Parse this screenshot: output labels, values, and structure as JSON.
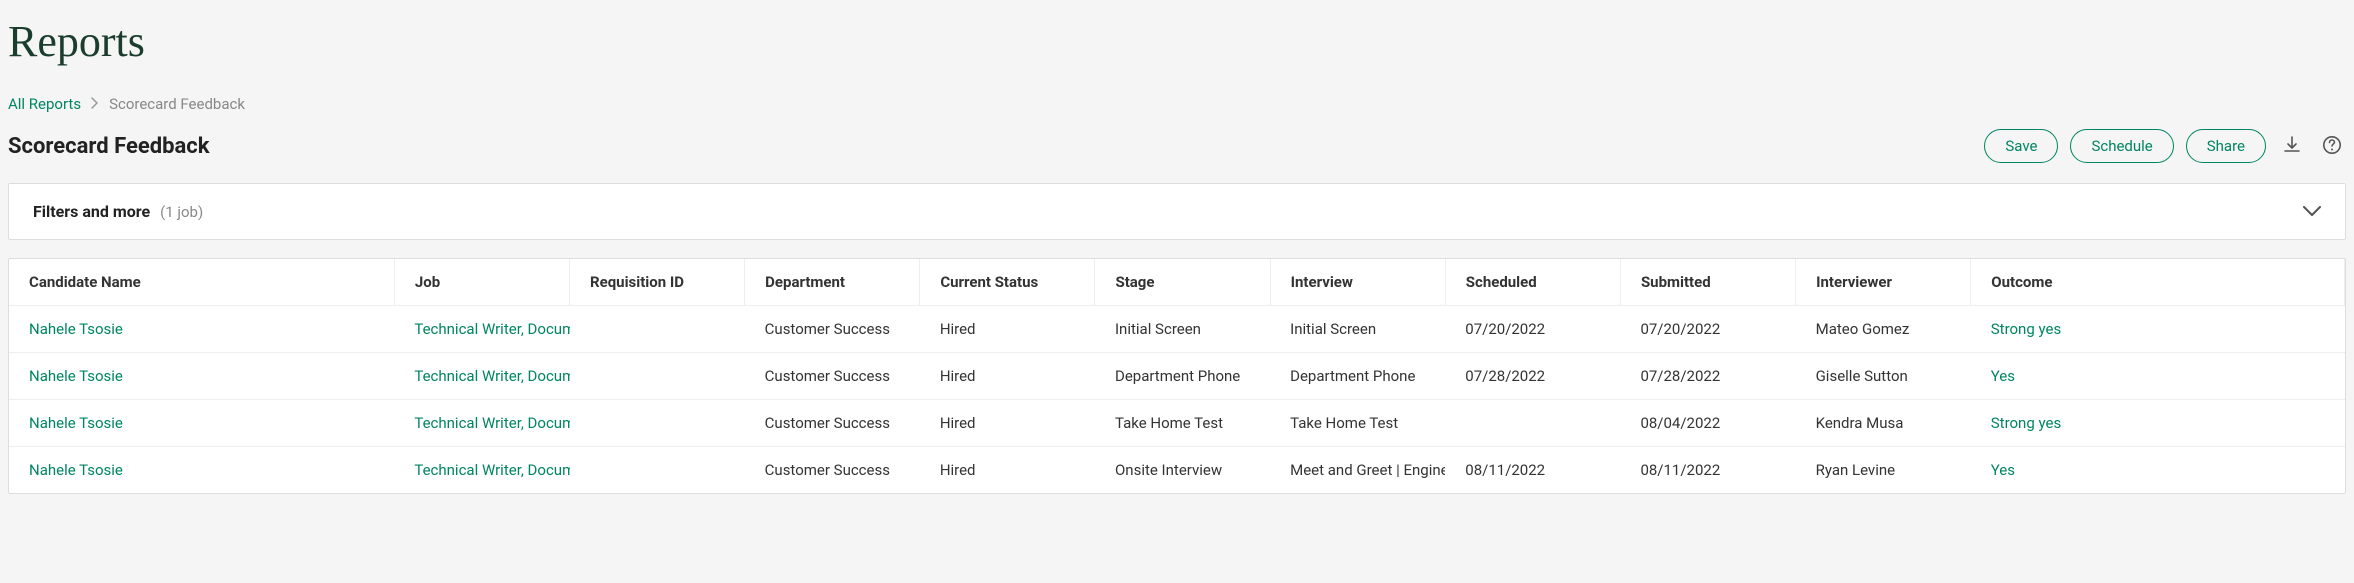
{
  "header": {
    "title": "Reports"
  },
  "breadcrumb": {
    "root": "All Reports",
    "current": "Scorecard Feedback"
  },
  "subheader": {
    "title": "Scorecard Feedback"
  },
  "actions": {
    "save": "Save",
    "schedule": "Schedule",
    "share": "Share"
  },
  "filters": {
    "label": "Filters and more",
    "count": "(1 job)"
  },
  "table": {
    "headers": {
      "candidate": "Candidate Name",
      "job": "Job",
      "requisition": "Requisition ID",
      "department": "Department",
      "status": "Current Status",
      "stage": "Stage",
      "interview": "Interview",
      "scheduled": "Scheduled",
      "submitted": "Submitted",
      "interviewer": "Interviewer",
      "outcome": "Outcome"
    },
    "rows": [
      {
        "candidate": "Nahele Tsosie",
        "job": "Technical Writer, Documentation",
        "requisition": "",
        "department": "Customer Success",
        "status": "Hired",
        "stage": "Initial Screen",
        "interview": "Initial Screen",
        "scheduled": "07/20/2022",
        "submitted": "07/20/2022",
        "interviewer": "Mateo Gomez",
        "outcome": "Strong yes"
      },
      {
        "candidate": "Nahele Tsosie",
        "job": "Technical Writer, Documentation",
        "requisition": "",
        "department": "Customer Success",
        "status": "Hired",
        "stage": "Department Phone",
        "interview": "Department Phone",
        "scheduled": "07/28/2022",
        "submitted": "07/28/2022",
        "interviewer": "Giselle Sutton",
        "outcome": "Yes"
      },
      {
        "candidate": "Nahele Tsosie",
        "job": "Technical Writer, Documentation",
        "requisition": "",
        "department": "Customer Success",
        "status": "Hired",
        "stage": "Take Home Test",
        "interview": "Take Home Test",
        "scheduled": "",
        "submitted": "08/04/2022",
        "interviewer": "Kendra Musa",
        "outcome": "Strong yes"
      },
      {
        "candidate": "Nahele Tsosie",
        "job": "Technical Writer, Documentation",
        "requisition": "",
        "department": "Customer Success",
        "status": "Hired",
        "stage": "Onsite Interview",
        "interview": "Meet and Greet | Engineering",
        "scheduled": "08/11/2022",
        "submitted": "08/11/2022",
        "interviewer": "Ryan Levine",
        "outcome": "Yes"
      }
    ]
  }
}
